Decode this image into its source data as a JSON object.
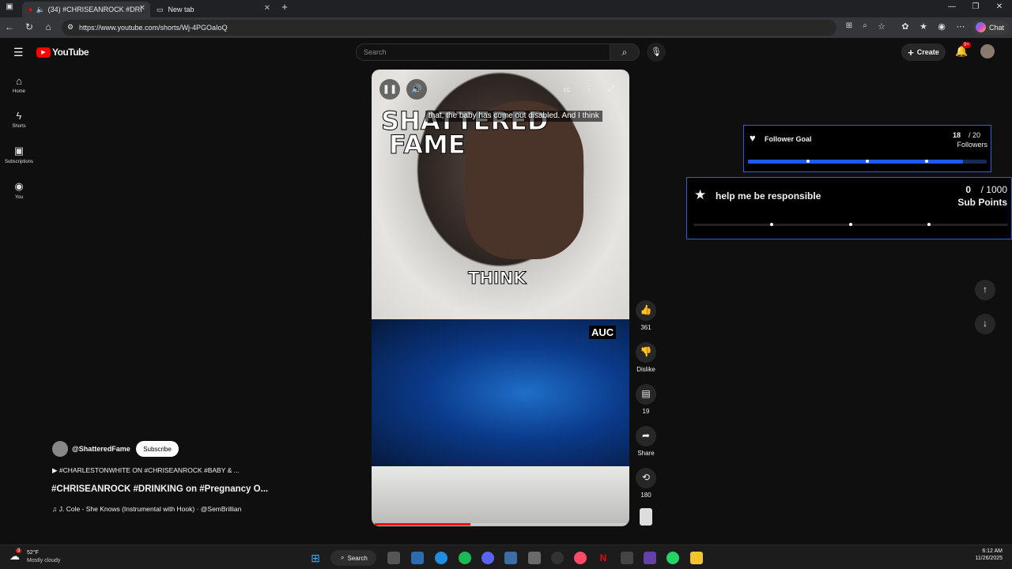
{
  "browser": {
    "tabs": [
      {
        "label": "(34) #CHRISEANROCK #DRI"
      },
      {
        "label": "New tab"
      }
    ],
    "url": "https://www.youtube.com/shorts/Wj-4PGOaIoQ",
    "chat_label": "Chat"
  },
  "youtube": {
    "logo": "YouTube",
    "search_placeholder": "Search",
    "create_label": "Create",
    "notif_count": "9+",
    "sidebar": [
      {
        "label": "Home"
      },
      {
        "label": "Shorts"
      },
      {
        "label": "Subscriptions"
      },
      {
        "label": "You"
      }
    ]
  },
  "video": {
    "caption_text": "that, the baby has come out disabled. And I think",
    "brand_line1": "SHATTERED",
    "brand_line2": "FAME",
    "overlay_word": "THINK",
    "overlay_logo": "AUC",
    "progress": 0.38
  },
  "actions": {
    "likes": "361",
    "dislike_label": "Dislike",
    "comments": "19",
    "share_label": "Share",
    "remix_count": "180"
  },
  "info": {
    "channel": "@ShatteredFame",
    "subscribe_label": "Subscribe",
    "tags": "▶ #CHARLESTONWHITE ON #CHRISEANROCK #BABY & ...",
    "title": "#CHRISEANROCK #DRINKING on #Pregnancy O...",
    "music": "♫ J. Cole - She Knows (Instrumental with Hook) · @SemBrillian"
  },
  "follower_goal": {
    "label": "Follower Goal",
    "current": "18",
    "total": "/ 20",
    "unit": "Followers",
    "progress": 0.9
  },
  "sub_points": {
    "label": "help me be responsible",
    "current": "0",
    "total": "/ 1000",
    "unit": "Sub Points",
    "progress": 0.0
  },
  "taskbar": {
    "weather_temp": "52°F",
    "weather_desc": "Mostly cloudy",
    "weather_badge": "3",
    "search_label": "Search",
    "time": "6:12 AM",
    "date": "11/26/2025"
  }
}
